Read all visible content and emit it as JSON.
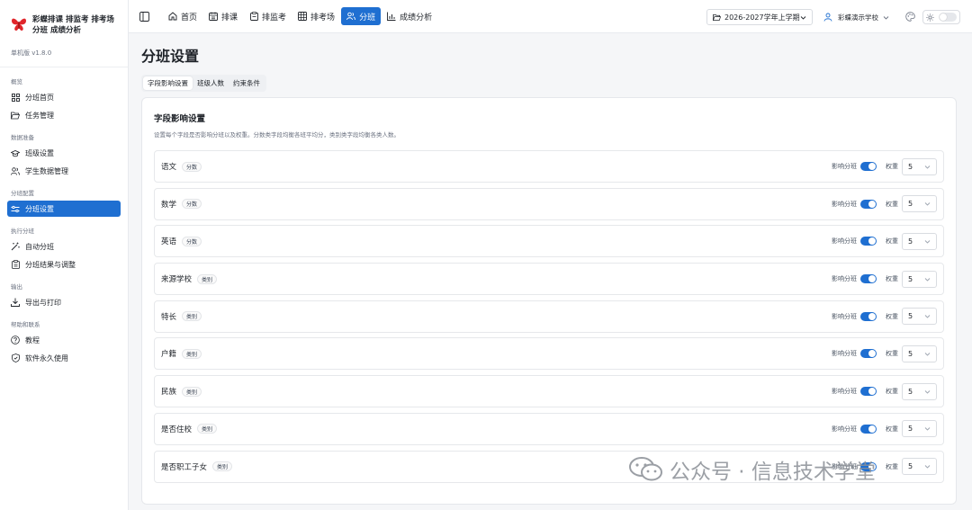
{
  "app": {
    "title": "彩蝶排课 排监考 排考场 分班 成绩分析",
    "version": "单机版 v1.8.0"
  },
  "sidebar": {
    "groups": [
      {
        "title": "概览",
        "items": [
          {
            "label": "分班首页",
            "icon": "grid-icon"
          },
          {
            "label": "任务管理",
            "icon": "folder-open-icon"
          }
        ]
      },
      {
        "title": "数据准备",
        "items": [
          {
            "label": "班级设置",
            "icon": "graduation-cap-icon"
          },
          {
            "label": "学生数据管理",
            "icon": "users-icon"
          }
        ]
      },
      {
        "title": "分班配置",
        "items": [
          {
            "label": "分班设置",
            "icon": "sliders-icon",
            "active": true
          }
        ]
      },
      {
        "title": "执行分班",
        "items": [
          {
            "label": "自动分班",
            "icon": "magic-wand-icon"
          },
          {
            "label": "分班结果与调整",
            "icon": "clipboard-icon"
          }
        ]
      },
      {
        "title": "输出",
        "items": [
          {
            "label": "导出与打印",
            "icon": "download-icon"
          }
        ]
      },
      {
        "title": "帮助和联系",
        "items": [
          {
            "label": "教程",
            "icon": "help-circle-icon"
          },
          {
            "label": "软件永久使用",
            "icon": "shield-check-icon"
          }
        ]
      }
    ]
  },
  "topbar": {
    "tabs": [
      {
        "label": "首页",
        "icon": "home-icon"
      },
      {
        "label": "排课",
        "icon": "calendar-icon"
      },
      {
        "label": "排监考",
        "icon": "clipboard-icon"
      },
      {
        "label": "排考场",
        "icon": "table-icon"
      },
      {
        "label": "分班",
        "icon": "users-icon",
        "active": true
      },
      {
        "label": "成绩分析",
        "icon": "bar-chart-icon"
      }
    ],
    "term": "2026-2027学年上学期",
    "school": "彩蝶演示学校"
  },
  "page": {
    "title": "分班设置",
    "subtabs": [
      "字段影响设置",
      "班级人数",
      "约束条件"
    ],
    "card": {
      "title": "字段影响设置",
      "description": "设置每个字段是否影响分班以及权重。分数类字段均衡各班平均分，类别类字段均衡各类人数。",
      "influence_label": "影响分班",
      "weight_label": "权重",
      "fields": [
        {
          "name": "语文",
          "tag": "分数",
          "influence": true,
          "weight": "5"
        },
        {
          "name": "数学",
          "tag": "分数",
          "influence": true,
          "weight": "5"
        },
        {
          "name": "英语",
          "tag": "分数",
          "influence": true,
          "weight": "5"
        },
        {
          "name": "来源学校",
          "tag": "类别",
          "influence": true,
          "weight": "5"
        },
        {
          "name": "特长",
          "tag": "类别",
          "influence": true,
          "weight": "5"
        },
        {
          "name": "户籍",
          "tag": "类别",
          "influence": true,
          "weight": "5"
        },
        {
          "name": "民族",
          "tag": "类别",
          "influence": true,
          "weight": "5"
        },
        {
          "name": "是否住校",
          "tag": "类别",
          "influence": true,
          "weight": "5"
        },
        {
          "name": "是否职工子女",
          "tag": "类别",
          "influence": true,
          "weight": "5"
        }
      ]
    }
  },
  "watermark": {
    "text": "公众号 · 信息技术学堂"
  },
  "colors": {
    "accent": "#1f6fd1",
    "brand": "#e0262b"
  }
}
